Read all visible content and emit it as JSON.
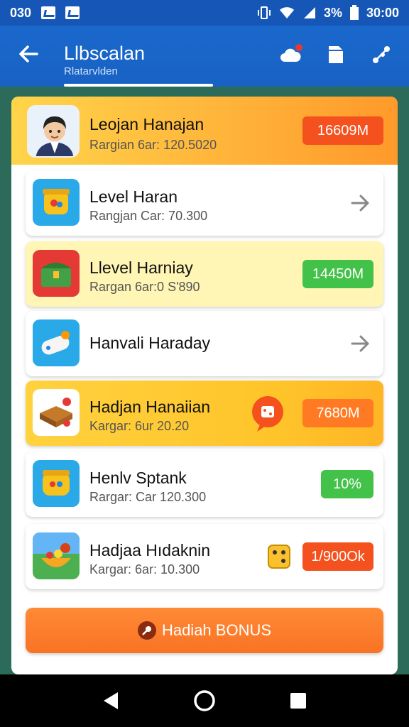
{
  "status": {
    "left_text": "030",
    "battery": "3%",
    "time": "30:00"
  },
  "appbar": {
    "title": "Llbscalan",
    "subtitle": "Rlatarvlden",
    "icons": [
      "cloud-icon",
      "document-icon",
      "share-icon"
    ]
  },
  "header": {
    "name": "Leojan Hanajan",
    "sub": "Rargian 6ar: 120.5020",
    "value": "16609M"
  },
  "rows": [
    {
      "title": "Level Haran",
      "sub": "Rangjan Car: 70.300",
      "action": "chevron",
      "value": ""
    },
    {
      "title": "Llevel Harniay",
      "sub": "Rargan 6ar:0 S'890",
      "action": "pill",
      "value": "14450M"
    },
    {
      "title": "Hanvali Haraday",
      "sub": "",
      "action": "chevron",
      "value": ""
    },
    {
      "title": "Hadjan Hanaiian",
      "sub": "Kargar: 6ur 20.20",
      "action": "pill",
      "value": "7680M"
    },
    {
      "title": "Henlv Sptank",
      "sub": "Rargar: Car 120.300",
      "action": "pill",
      "value": "10%"
    },
    {
      "title": "Hadjaa Hıdaknin",
      "sub": "Kargar: 6ar: 10.300",
      "action": "pill",
      "value": "1/900Ok"
    }
  ],
  "bonus": {
    "label": "Hadiah BONUS"
  },
  "colors": {
    "primary": "#1a68cc",
    "orange": "#f4511e",
    "green": "#43c24a",
    "gold": "#ffc42a"
  }
}
